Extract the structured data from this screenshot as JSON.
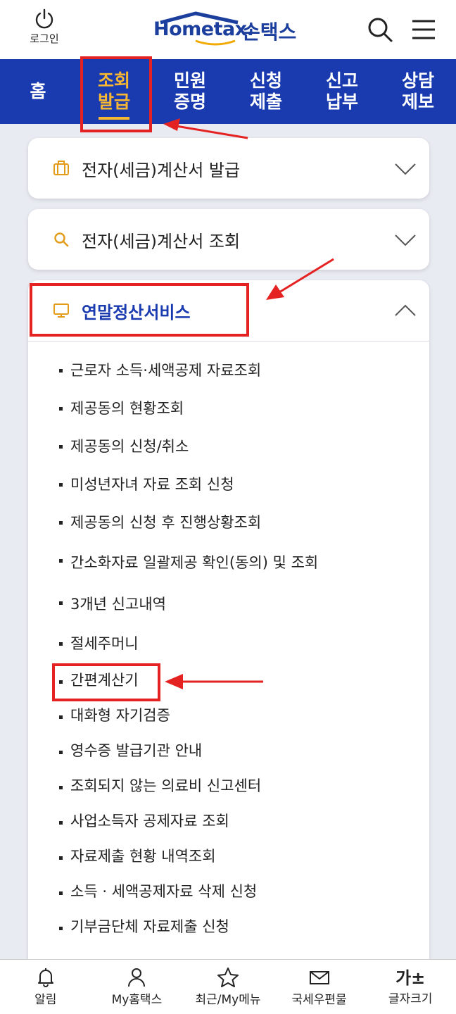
{
  "header": {
    "login_label": "로그인",
    "logo_text": "Hometax.",
    "logo_sub": "손택스"
  },
  "nav": {
    "items": [
      {
        "l1": "홈",
        "l2": ""
      },
      {
        "l1": "조회",
        "l2": "발급"
      },
      {
        "l1": "민원",
        "l2": "증명"
      },
      {
        "l1": "신청",
        "l2": "제출"
      },
      {
        "l1": "신고",
        "l2": "납부"
      },
      {
        "l1": "상담",
        "l2": "제보"
      }
    ]
  },
  "sections": [
    {
      "title": "전자(세금)계산서 발급"
    },
    {
      "title": "전자(세금)계산서 조회"
    },
    {
      "title": "연말정산서비스"
    }
  ],
  "list": [
    "근로자 소득·세액공제 자료조회",
    "제공동의 현황조회",
    "제공동의 신청/취소",
    "미성년자녀 자료 조회 신청",
    "제공동의 신청 후 진행상황조회",
    "간소화자료 일괄제공 확인(동의) 및 조회",
    "3개년 신고내역",
    "절세주머니",
    "간편계산기",
    "대화형 자기검증",
    "영수증 발급기관 안내",
    "조회되지 않는 의료비 신고센터",
    "사업소득자 공제자료 조회",
    "자료제출 현황 내역조회",
    "소득 · 세액공제자료 삭제 신청",
    "기부금단체 자료제출 신청"
  ],
  "bottom": {
    "tabs": [
      "알림",
      "My홈택스",
      "최근/My메뉴",
      "국세우편물",
      "글자크기"
    ],
    "font_glyph": "가±"
  },
  "colors": {
    "nav_bg": "#1a3bb0",
    "active": "#f7b733",
    "annotation": "#e52222"
  }
}
